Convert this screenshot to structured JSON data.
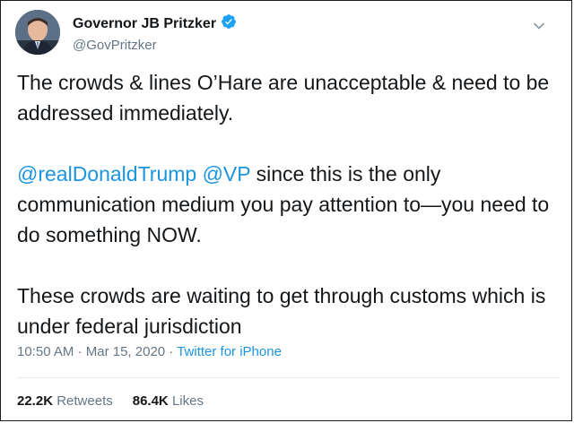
{
  "author": {
    "display_name": "Governor JB Pritzker",
    "handle": "@GovPritzker",
    "verified": true
  },
  "tweet": {
    "paragraph_1": "The crowds & lines O’Hare are unacceptable & need to be addressed immediately.",
    "mention_1": "@realDonaldTrump",
    "mention_2": "@VP",
    "paragraph_2_rest": " since this is the only communication medium you pay attention to—you need to do something NOW.",
    "paragraph_3": "These crowds are waiting to get through customs which is under federal jurisdiction"
  },
  "meta": {
    "time": "10:50 AM",
    "sep1": " · ",
    "date": "Mar 15, 2020",
    "sep2": " · ",
    "source": "Twitter for iPhone"
  },
  "stats": {
    "retweets_count": "22.2K",
    "retweets_label": "Retweets",
    "likes_count": "86.4K",
    "likes_label": "Likes"
  },
  "colors": {
    "accent": "#1b95e0",
    "verified": "#1da1f2",
    "muted": "#657786",
    "text": "#14171a"
  },
  "icons": {
    "verified": "verified-badge-icon",
    "menu": "chevron-down-icon"
  }
}
